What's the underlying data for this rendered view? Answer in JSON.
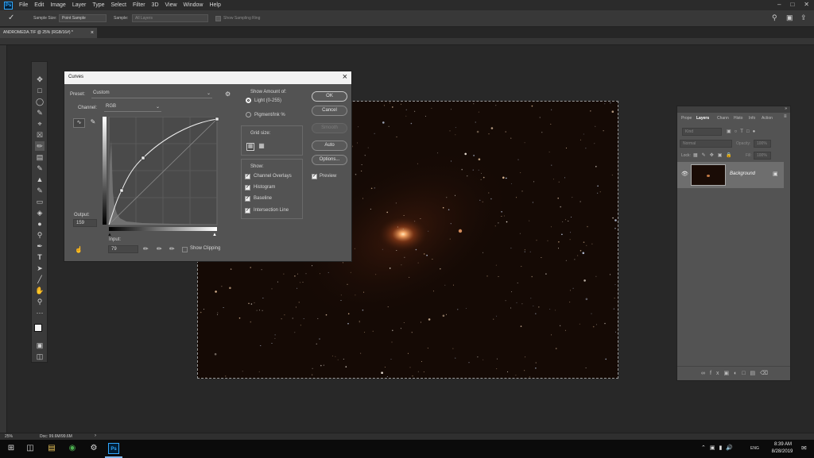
{
  "app": {
    "logo": "Ps",
    "menu": [
      "File",
      "Edit",
      "Image",
      "Layer",
      "Type",
      "Select",
      "Filter",
      "3D",
      "View",
      "Window",
      "Help"
    ]
  },
  "options_bar": {
    "sample_size_label": "Sample Size:",
    "sample_size_value": "Point Sample",
    "sample_label": "Sample:",
    "sample_value": "All Layers",
    "show_sampling_ring": "Show Sampling Ring"
  },
  "document_tab": {
    "title": "ANDROMEDA.TIF @ 25% (RGB/16#) *",
    "close": "×"
  },
  "curves_dialog": {
    "title": "Curves",
    "preset_label": "Preset:",
    "preset_value": "Custom",
    "channel_label": "Channel:",
    "channel_value": "RGB",
    "output_label": "Output:",
    "output_value": "159",
    "input_label": "Input:",
    "input_value": "79",
    "show_clipping": "Show Clipping",
    "show_amount_label": "Show Amount of:",
    "light_option": "Light  (0-255)",
    "pigment_option": "Pigment/Ink %",
    "grid_size_label": "Grid size:",
    "show_label": "Show:",
    "show_options": [
      "Channel Overlays",
      "Histogram",
      "Baseline",
      "Intersection Line"
    ],
    "ok": "OK",
    "cancel": "Cancel",
    "smooth": "Smooth",
    "auto": "Auto",
    "options": "Options...",
    "preview": "Preview"
  },
  "layers_panel": {
    "tabs": [
      "Prope",
      "Layers",
      "Chann",
      "Histo",
      "Info",
      "Action"
    ],
    "active_tab": "Layers",
    "kind_placeholder": "Kind",
    "blend_mode": "Normal",
    "opacity_label": "Opacity:",
    "opacity_value": "100%",
    "lock_label": "Lock:",
    "fill_label": "Fill:",
    "fill_value": "100%",
    "layer_name": "Background"
  },
  "status_bar": {
    "zoom": "25%",
    "doc_info": "Doc: 99.6M/99.6M"
  },
  "taskbar": {
    "time": "8:39 AM",
    "date": "8/28/2019",
    "lang": "ENG"
  },
  "colors": {
    "accent_blue": "#31a8ff",
    "panel": "#535353",
    "canvas_bg": "#150a05"
  }
}
